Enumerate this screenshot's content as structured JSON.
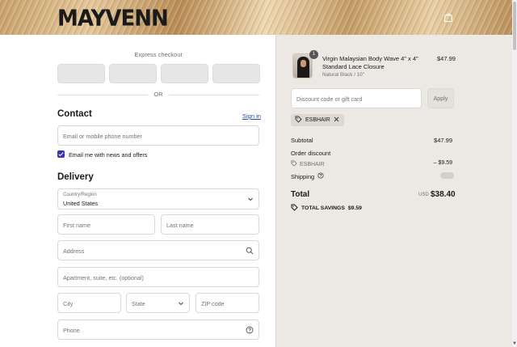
{
  "brand": {
    "logo": "MAYVENN"
  },
  "express": {
    "title": "Express checkout",
    "or": "OR"
  },
  "contact": {
    "heading": "Contact",
    "signin": "Sign in",
    "email_placeholder": "Email or mobile phone number",
    "news_label": "Email me with news and offers",
    "news_checked": true
  },
  "delivery": {
    "heading": "Delivery",
    "country_label": "Country/Region",
    "country_value": "United States",
    "first_name": "First name",
    "last_name": "Last name",
    "address": "Address",
    "apartment": "Apartment, suite, etc. (optional)",
    "city": "City",
    "state": "State",
    "zip": "ZIP code",
    "phone": "Phone"
  },
  "cart": {
    "item": {
      "quantity": "1",
      "name": "Virgin Malaysian Body Wave 4\" x 4\" Standard Lace Closure",
      "variant": "Natural Black / 10\"",
      "price": "$47.99"
    },
    "discount_placeholder": "Discount code or gift card",
    "apply_label": "Apply",
    "applied_code": "ESBHAIR",
    "subtotal_label": "Subtotal",
    "subtotal_value": "$47.99",
    "order_discount_label": "Order discount",
    "discount_code": "ESBHAIR",
    "discount_value": "– $9.59",
    "shipping_label": "Shipping",
    "total_label": "Total",
    "currency": "USD",
    "total_value": "$38.40",
    "savings_label": "TOTAL SAVINGS",
    "savings_value": "$9.59"
  },
  "colors": {
    "accent": "#3b34b2",
    "link": "#1f4fb5",
    "summary_bg": "#ece8e3"
  },
  "icons": [
    "shopping-bag-icon",
    "chevron-down-icon",
    "search-icon",
    "help-circle-icon",
    "tag-icon",
    "close-icon",
    "checkmark-icon"
  ]
}
